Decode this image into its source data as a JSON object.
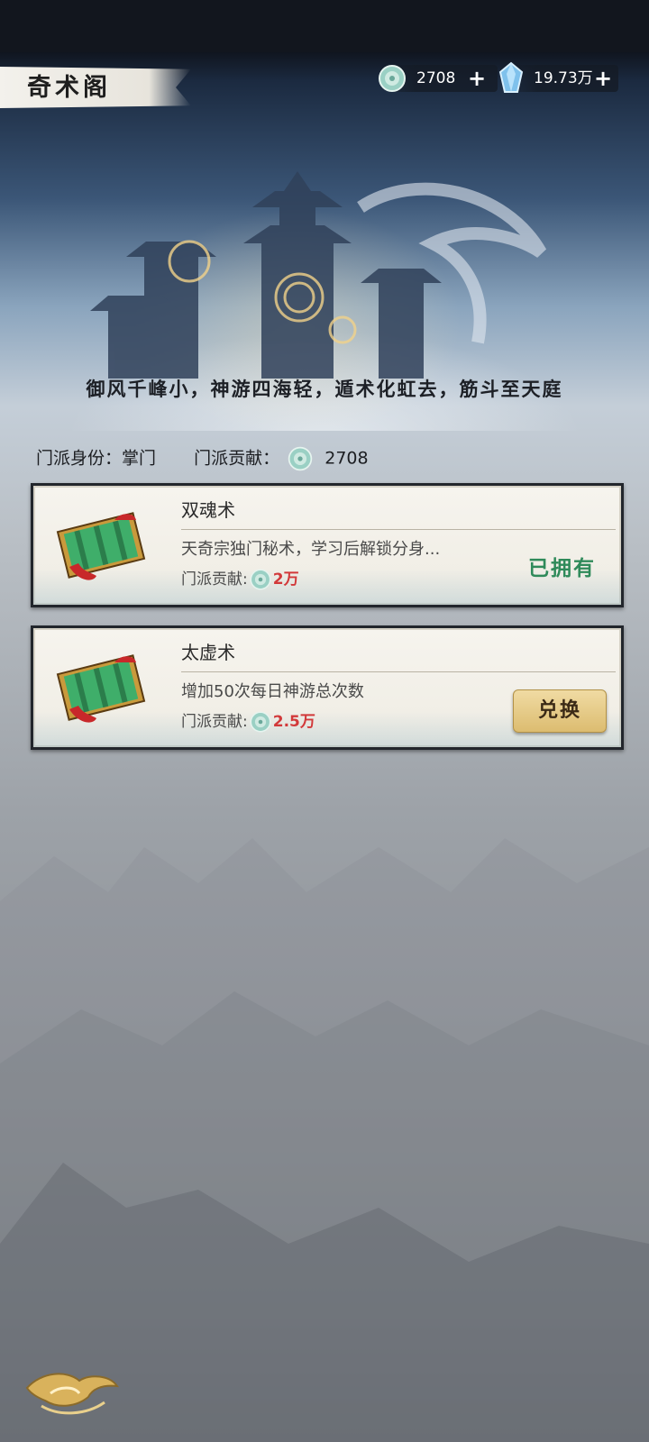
{
  "header": {
    "title": "奇术阁",
    "resources": [
      {
        "icon": "jade-token-icon",
        "value": "2708"
      },
      {
        "icon": "crystal-icon",
        "value": "19.73万"
      }
    ],
    "plus_label": "+"
  },
  "slogan": "御风千峰小，神游四海轻，遁术化虹去，筋斗至天庭",
  "sect": {
    "identity_label": "门派身份：",
    "identity_value": "掌门",
    "contribution_label": "门派贡献：",
    "contribution_value": "2708"
  },
  "skills": [
    {
      "name": "双魂术",
      "desc": "天奇宗独门秘术，学习后解锁分身...",
      "cost_label": "门派贡献:",
      "cost_value": "2万",
      "status": "已拥有"
    },
    {
      "name": "太虚术",
      "desc": "增加50次每日神游总次数",
      "cost_label": "门派贡献:",
      "cost_value": "2.5万",
      "button": "兑换"
    }
  ],
  "colors": {
    "owned": "#2f8a5a",
    "cost": "#d2393a",
    "button": "#e6c987"
  }
}
